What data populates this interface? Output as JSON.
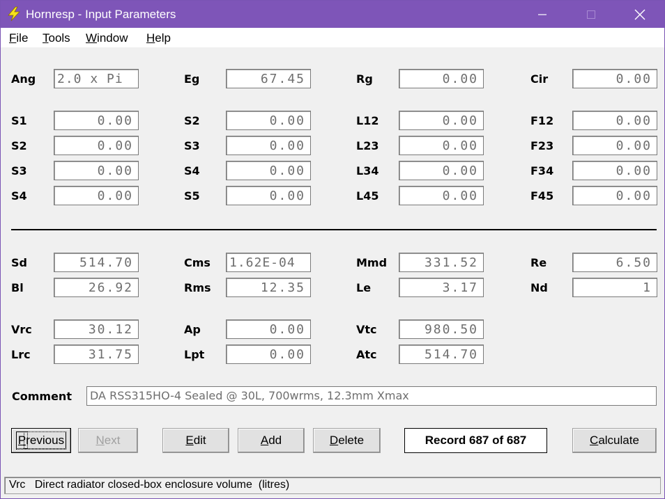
{
  "window": {
    "title": "Hornresp - Input Parameters",
    "accent_color": "#7e55b8",
    "icon": "lightning-bolt-icon"
  },
  "menu": [
    {
      "pre": "",
      "acc": "F",
      "post": "ile"
    },
    {
      "pre": "",
      "acc": "T",
      "post": "ools"
    },
    {
      "pre": "",
      "acc": "W",
      "post": "indow"
    },
    {
      "pre": "",
      "acc": "H",
      "post": "elp"
    }
  ],
  "params": {
    "ang": {
      "label": "Ang",
      "value": "2.0 x Pi"
    },
    "eg": {
      "label": "Eg",
      "value": "67.45"
    },
    "rg": {
      "label": "Rg",
      "value": "0.00"
    },
    "cir": {
      "label": "Cir",
      "value": "0.00"
    },
    "c1": [
      {
        "label": "S1",
        "value": "0.00"
      },
      {
        "label": "S2",
        "value": "0.00"
      },
      {
        "label": "S3",
        "value": "0.00"
      },
      {
        "label": "S4",
        "value": "0.00"
      }
    ],
    "c2": [
      {
        "label": "S2",
        "value": "0.00"
      },
      {
        "label": "S3",
        "value": "0.00"
      },
      {
        "label": "S4",
        "value": "0.00"
      },
      {
        "label": "S5",
        "value": "0.00"
      }
    ],
    "c3": [
      {
        "label": "L12",
        "value": "0.00"
      },
      {
        "label": "L23",
        "value": "0.00"
      },
      {
        "label": "L34",
        "value": "0.00"
      },
      {
        "label": "L45",
        "value": "0.00"
      }
    ],
    "c4": [
      {
        "label": "F12",
        "value": "0.00"
      },
      {
        "label": "F23",
        "value": "0.00"
      },
      {
        "label": "F34",
        "value": "0.00"
      },
      {
        "label": "F45",
        "value": "0.00"
      }
    ],
    "sd": {
      "label": "Sd",
      "value": "514.70"
    },
    "cms": {
      "label": "Cms",
      "value": "1.62E-04"
    },
    "mmd": {
      "label": "Mmd",
      "value": "331.52"
    },
    "re": {
      "label": "Re",
      "value": "6.50"
    },
    "bl": {
      "label": "Bl",
      "value": "26.92"
    },
    "rms": {
      "label": "Rms",
      "value": "12.35"
    },
    "le": {
      "label": "Le",
      "value": "3.17"
    },
    "nd": {
      "label": "Nd",
      "value": "1"
    },
    "vrc": {
      "label": "Vrc",
      "value": "30.12"
    },
    "ap": {
      "label": "Ap",
      "value": "0.00"
    },
    "vtc": {
      "label": "Vtc",
      "value": "980.50"
    },
    "lrc": {
      "label": "Lrc",
      "value": "31.75"
    },
    "lpt": {
      "label": "Lpt",
      "value": "0.00"
    },
    "atc": {
      "label": "Atc",
      "value": "514.70"
    }
  },
  "comment": {
    "label": "Comment",
    "value": "DA RSS315HO-4 Sealed @ 30L, 700wrms, 12.3mm Xmax"
  },
  "buttons": {
    "previous": {
      "acc": "P",
      "post": "revious"
    },
    "next": {
      "acc": "N",
      "post": "ext"
    },
    "edit": {
      "acc": "E",
      "post": "dit"
    },
    "add": {
      "acc": "A",
      "post": "dd"
    },
    "delete": {
      "acc": "D",
      "post": "elete"
    },
    "calculate": {
      "acc": "C",
      "post": "alculate"
    }
  },
  "record": "Record 687 of 687",
  "status": "Vrc   Direct radiator closed-box enclosure volume  (litres)"
}
